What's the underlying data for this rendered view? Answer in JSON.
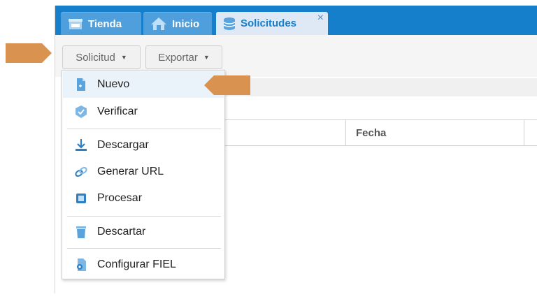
{
  "tabs": [
    {
      "label": "Tienda",
      "icon": "store-icon",
      "active": false
    },
    {
      "label": "Inicio",
      "icon": "home-icon",
      "active": false
    },
    {
      "label": "Solicitudes",
      "icon": "database-icon",
      "active": true,
      "close": "×"
    }
  ],
  "toolbar": {
    "solicitud_label": "Solicitud",
    "exportar_label": "Exportar"
  },
  "grid": {
    "columns": [
      "Fecha"
    ]
  },
  "menu": {
    "items": [
      {
        "label": "Nuevo",
        "icon": "new-document-icon"
      },
      {
        "label": "Verificar",
        "icon": "verify-shield-icon"
      },
      {
        "label": "Descargar",
        "icon": "download-icon"
      },
      {
        "label": "Generar URL",
        "icon": "link-icon"
      },
      {
        "label": "Procesar",
        "icon": "chip-icon"
      },
      {
        "label": "Descartar",
        "icon": "trash-icon"
      },
      {
        "label": "Configurar FIEL",
        "icon": "certificate-icon"
      }
    ]
  },
  "colors": {
    "tabbar": "#157fcc",
    "annotation_arrow": "#d99250",
    "menu_hover": "#eaf2fa"
  }
}
